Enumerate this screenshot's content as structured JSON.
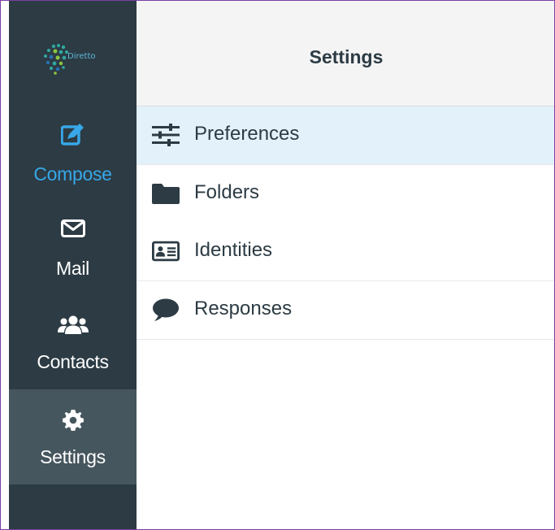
{
  "sidebar": {
    "logo_text": "Diretto",
    "items": [
      {
        "label": "Compose",
        "icon": "compose-icon",
        "active_color": "#37a8e8"
      },
      {
        "label": "Mail",
        "icon": "envelope-icon"
      },
      {
        "label": "Contacts",
        "icon": "users-icon"
      },
      {
        "label": "Settings",
        "icon": "gear-icon",
        "selected": true
      }
    ],
    "background": "#2c3b44",
    "selected_background": "#46565e"
  },
  "header": {
    "title": "Settings"
  },
  "settings_menu": {
    "items": [
      {
        "label": "Preferences",
        "icon": "sliders-icon",
        "selected": true
      },
      {
        "label": "Folders",
        "icon": "folder-icon"
      },
      {
        "label": "Identities",
        "icon": "id-card-icon"
      },
      {
        "label": "Responses",
        "icon": "speech-bubble-icon"
      }
    ],
    "selected_background": "#e3f1fb"
  }
}
